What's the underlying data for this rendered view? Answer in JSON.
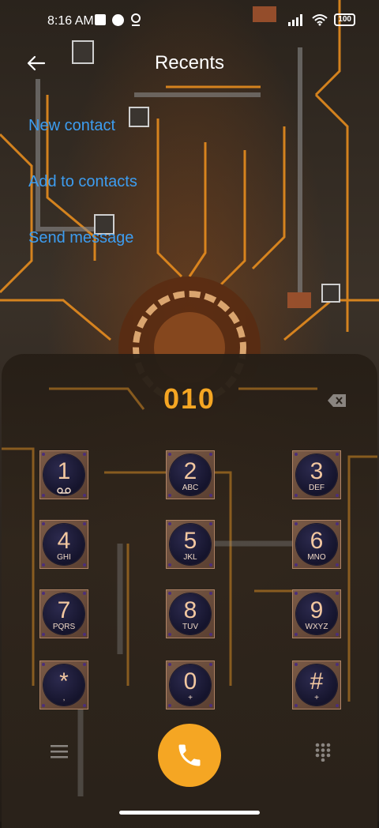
{
  "status_bar": {
    "time": "8:16 AM",
    "battery": "100"
  },
  "header": {
    "title": "Recents"
  },
  "actions": {
    "new_contact": "New contact",
    "add_to_contacts": "Add to contacts",
    "send_message": "Send message"
  },
  "dialer": {
    "number": "010",
    "keys": [
      {
        "digit": "1",
        "letters": "voicemail-icon"
      },
      {
        "digit": "2",
        "letters": "ABC"
      },
      {
        "digit": "3",
        "letters": "DEF"
      },
      {
        "digit": "4",
        "letters": "GHI"
      },
      {
        "digit": "5",
        "letters": "JKL"
      },
      {
        "digit": "6",
        "letters": "MNO"
      },
      {
        "digit": "7",
        "letters": "PQRS"
      },
      {
        "digit": "8",
        "letters": "TUV"
      },
      {
        "digit": "9",
        "letters": "WXYZ"
      },
      {
        "digit": "*",
        "letters": ","
      },
      {
        "digit": "0",
        "letters": "+"
      },
      {
        "digit": "#",
        "letters": "+"
      }
    ]
  },
  "colors": {
    "accent": "#f5a623",
    "link": "#3d9df0"
  }
}
